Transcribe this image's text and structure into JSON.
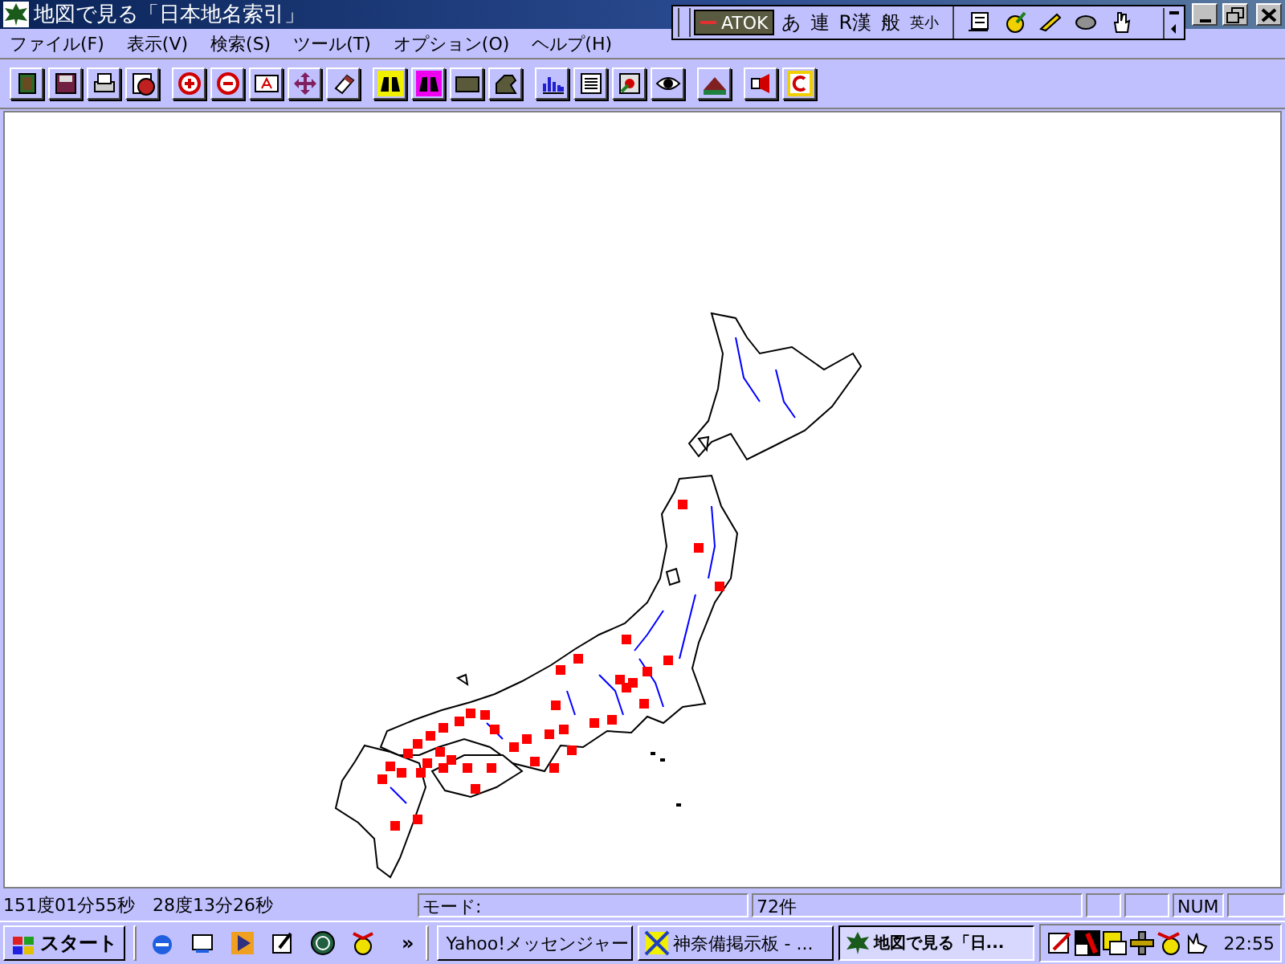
{
  "window": {
    "title": "地図で見る「日本地名索引」"
  },
  "menu": [
    {
      "label": "ファイル(F)"
    },
    {
      "label": "表示(V)"
    },
    {
      "label": "検索(S)"
    },
    {
      "label": "ツール(T)"
    },
    {
      "label": "オプション(O)"
    },
    {
      "label": "ヘルプ(H)"
    }
  ],
  "ime_bar": {
    "items": [
      "ATOK",
      "あ",
      "連",
      "R漢",
      "般",
      "英小"
    ]
  },
  "status_bar": {
    "coordinates": "151度01分55秒　28度13分26秒",
    "mode": "モード:",
    "count": "72件",
    "num_lock": "NUM"
  },
  "taskbar": {
    "start": "スタート",
    "more": "»",
    "tasks": [
      {
        "label": "Yahoo!メッセンジャー",
        "selected": false
      },
      {
        "label": "神奈備掲示板 - ...",
        "selected": false
      },
      {
        "label": "地図で見る「日...",
        "selected": true
      }
    ],
    "clock": "22:55"
  }
}
